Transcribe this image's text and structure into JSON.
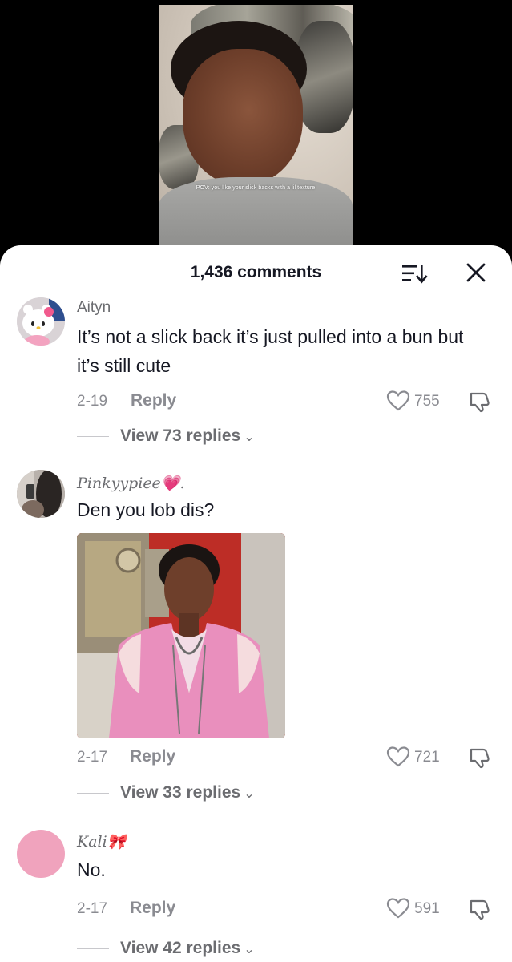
{
  "video": {
    "caption": "POV: you like your slick backs with a lil texture"
  },
  "sheet": {
    "count_label": "1,436 comments"
  },
  "icons": {
    "sort": "sort-icon",
    "close": "close-icon",
    "like": "heart-icon",
    "dislike": "dislike-icon"
  },
  "comments": [
    {
      "username": "Aityn",
      "text": "It’s not a slick back it’s just pulled into a bun but it’s still cute",
      "date": "2-19",
      "reply_label": "Reply",
      "likes": "755",
      "view_replies": "View 73 replies"
    },
    {
      "username": "Pinkyypiee💗.",
      "text": "Den you lob dis?",
      "date": "2-17",
      "reply_label": "Reply",
      "likes": "721",
      "view_replies": "View 33 replies"
    },
    {
      "username": "Kali🎀",
      "text": "No.",
      "date": "2-17",
      "reply_label": "Reply",
      "likes": "591",
      "view_replies": "View 42 replies"
    }
  ],
  "colors": {
    "sheet_bg": "#ffffff",
    "text_primary": "#161823",
    "text_secondary": "#8a8b91",
    "avatar_pink": "#f0a3bd"
  }
}
